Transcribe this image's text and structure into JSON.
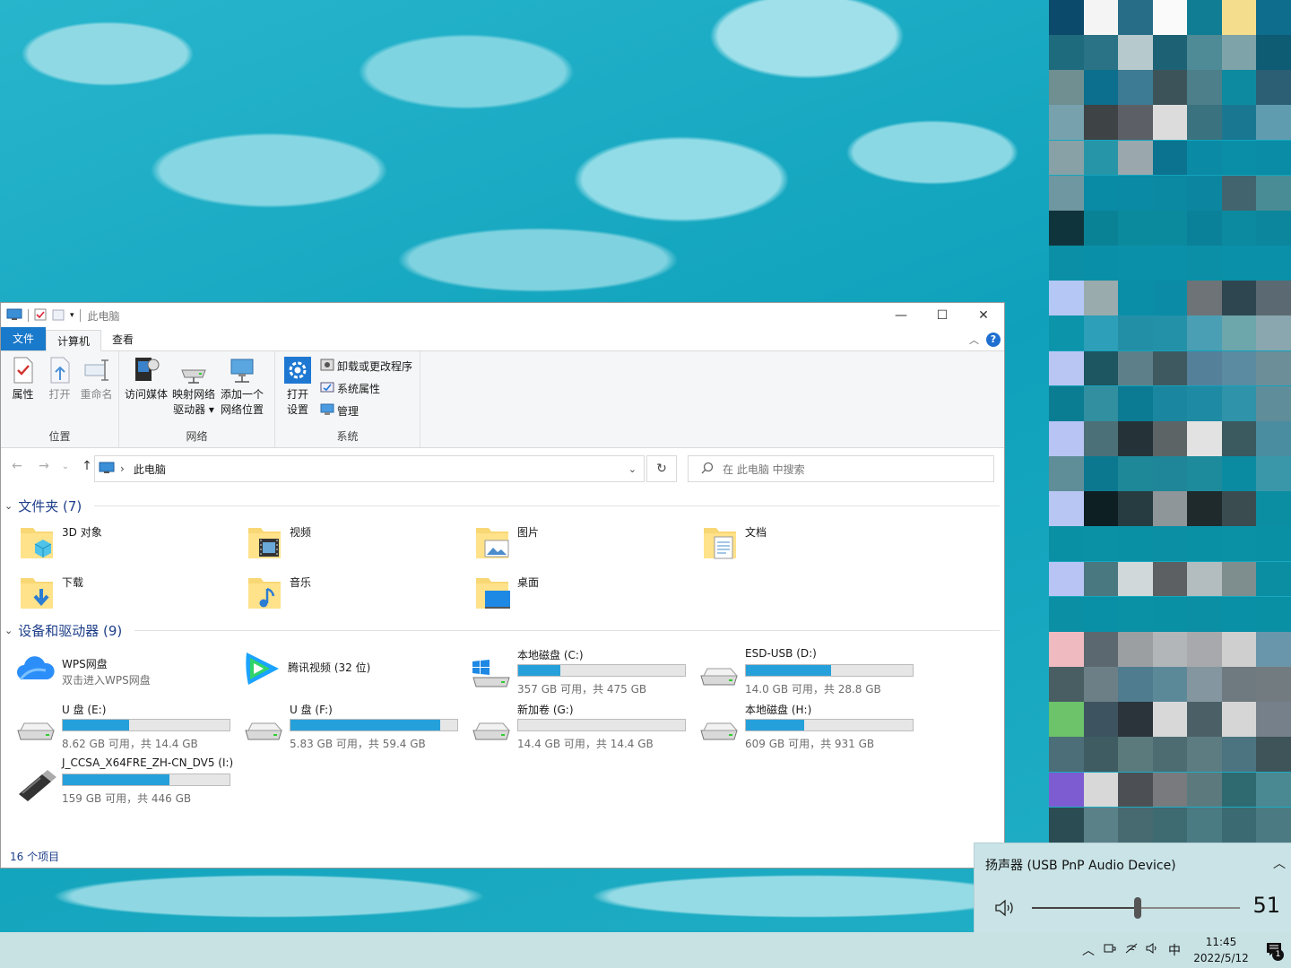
{
  "explorer": {
    "title": "此电脑",
    "window_buttons": {
      "minimize": "—",
      "maximize": "☐",
      "close": "✕"
    },
    "tabs": {
      "file": "文件",
      "computer": "计算机",
      "view": "查看"
    },
    "ribbon": {
      "location": {
        "label": "位置",
        "properties": "属性",
        "open": "打开",
        "rename": "重命名"
      },
      "network": {
        "label": "网络",
        "access_media": "访问媒体",
        "map_drive": "映射网络\n驱动器 ▾",
        "add_location": "添加一个\n网络位置"
      },
      "system": {
        "label": "系统",
        "open_settings": "打开\n设置",
        "uninstall": "卸载或更改程序",
        "sys_props": "系统属性",
        "manage": "管理"
      }
    },
    "nav": {
      "back": "←",
      "forward": "→",
      "recent": "⌄",
      "up": "↑",
      "breadcrumb_sep": "›",
      "breadcrumb": "此电脑",
      "dropdown": "⌄",
      "refresh": "↻",
      "search_placeholder": "在 此电脑 中搜索"
    },
    "folders_header": "文件夹 (7)",
    "folders": {
      "objects3d": "3D 对象",
      "videos": "视频",
      "pictures": "图片",
      "documents": "文档",
      "downloads": "下载",
      "music": "音乐",
      "desktop": "桌面"
    },
    "devices_header": "设备和驱动器 (9)",
    "apps": {
      "wps": {
        "name": "WPS网盘",
        "sub": "双击进入WPS网盘"
      },
      "tencent": {
        "name": "腾讯视频 (32 位)"
      }
    },
    "drives": {
      "c": {
        "name": "本地磁盘 (C:)",
        "info": "357 GB 可用，共 475 GB",
        "used_fraction": 0.25
      },
      "d": {
        "name": "ESD-USB (D:)",
        "info": "14.0 GB 可用，共 28.8 GB",
        "used_fraction": 0.51
      },
      "e": {
        "name": "U 盘 (E:)",
        "info": "8.62 GB 可用，共 14.4 GB",
        "used_fraction": 0.4
      },
      "f": {
        "name": "U 盘 (F:)",
        "info": "5.83 GB 可用，共 59.4 GB",
        "used_fraction": 0.9
      },
      "g": {
        "name": "新加卷 (G:)",
        "info": "14.4 GB 可用，共 14.4 GB",
        "used_fraction": 0.0
      },
      "h": {
        "name": "本地磁盘 (H:)",
        "info": "609 GB 可用，共 931 GB",
        "used_fraction": 0.35
      },
      "i": {
        "name": "J_CCSA_X64FRE_ZH-CN_DV5 (I:)",
        "info": "159 GB 可用，共 446 GB",
        "used_fraction": 0.64
      }
    },
    "status": "16 个项目"
  },
  "volume_flyout": {
    "device": "扬声器 (USB PnP Audio Device)",
    "chevron": "︿",
    "value": "51",
    "level_fraction": 0.51
  },
  "taskbar": {
    "time": "11:45",
    "date": "2022/5/12",
    "ime": "中",
    "notification_count": "1",
    "tray_chevron": "︿"
  },
  "colors": {
    "accent": "#1979ca",
    "drive_bar": "#26a0da",
    "taskbar": "#c8e2e4",
    "header_blue": "#1e3f8a"
  }
}
